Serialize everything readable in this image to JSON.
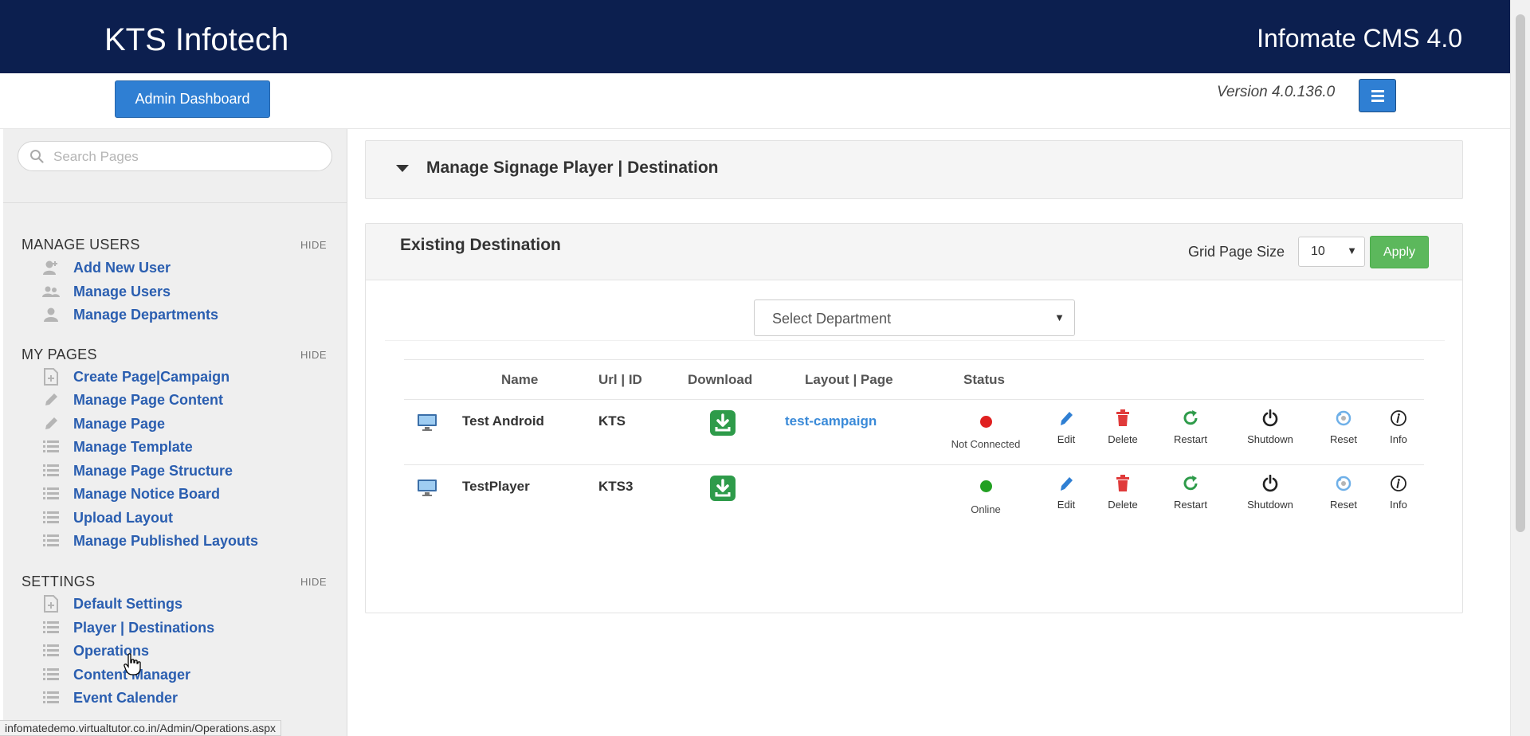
{
  "header": {
    "brand": "KTS Infotech",
    "product": "Infomate CMS 4.0",
    "admin_button": "Admin Dashboard",
    "version": "Version 4.0.136.0",
    "menu_icon": "list-icon"
  },
  "sidebar": {
    "search_placeholder": "Search Pages",
    "hide_label": "HIDE",
    "sections": [
      {
        "title": "MANAGE USERS",
        "items": [
          {
            "label": "Add New User",
            "icon": "user-add-icon"
          },
          {
            "label": "Manage Users",
            "icon": "users-icon"
          },
          {
            "label": "Manage Departments",
            "icon": "user-icon"
          }
        ]
      },
      {
        "title": "MY PAGES",
        "items": [
          {
            "label": "Create Page|Campaign",
            "icon": "page-add-icon"
          },
          {
            "label": "Manage Page Content",
            "icon": "pencil-icon"
          },
          {
            "label": "Manage Page",
            "icon": "pencil-icon"
          },
          {
            "label": "Manage Template",
            "icon": "list-icon"
          },
          {
            "label": "Manage Page Structure",
            "icon": "list-icon"
          },
          {
            "label": "Manage Notice Board",
            "icon": "list-icon"
          },
          {
            "label": "Upload Layout",
            "icon": "list-icon"
          },
          {
            "label": "Manage Published Layouts",
            "icon": "list-icon"
          }
        ]
      },
      {
        "title": "SETTINGS",
        "items": [
          {
            "label": "Default Settings",
            "icon": "page-add-icon"
          },
          {
            "label": "Player | Destinations",
            "icon": "list-icon"
          },
          {
            "label": "Operations",
            "icon": "list-icon"
          },
          {
            "label": "Content Manager",
            "icon": "list-icon"
          },
          {
            "label": "Event Calender",
            "icon": "list-icon"
          }
        ]
      }
    ]
  },
  "main": {
    "panel_title": "Manage Signage Player | Destination",
    "existing_title": "Existing Destination",
    "grid_page_size_label": "Grid Page Size",
    "grid_page_size_value": "10",
    "apply_label": "Apply",
    "department_placeholder": "Select Department",
    "columns": [
      "Name",
      "Url | ID",
      "Download",
      "Layout | Page",
      "Status"
    ],
    "rows": [
      {
        "name": "Test Android",
        "url_id": "KTS",
        "layout_page": "test-campaign",
        "status": "Not Connected",
        "status_color": "#e02020"
      },
      {
        "name": "TestPlayer",
        "url_id": "KTS3",
        "layout_page": "",
        "status": "Online",
        "status_color": "#22a022"
      }
    ],
    "actions": [
      "Edit",
      "Delete",
      "Restart",
      "Shutdown",
      "Reset",
      "Info"
    ]
  },
  "statusbar": {
    "url": "infomatedemo.virtualtutor.co.in/Admin/Operations.aspx"
  },
  "colors": {
    "header_bg": "#0c1f4f",
    "primary": "#2f7fd3",
    "success": "#5cb85c",
    "link": "#2a5eb0"
  }
}
